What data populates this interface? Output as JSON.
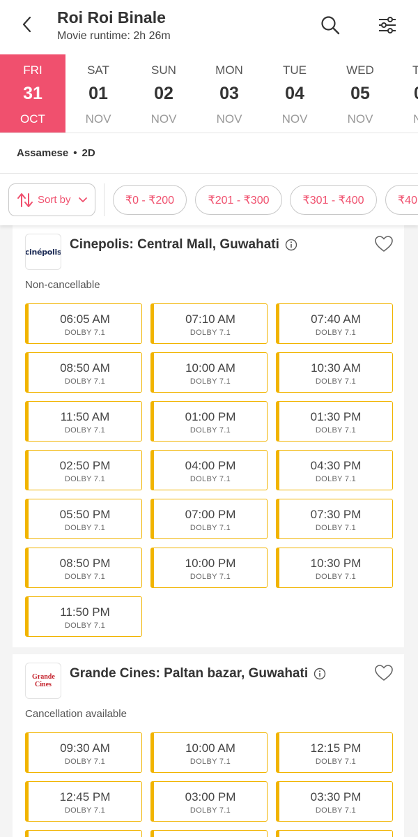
{
  "header": {
    "title": "Roi Roi Binale",
    "subtitle": "Movie runtime: 2h 26m"
  },
  "dates": [
    {
      "dow": "FRI",
      "day": "31",
      "mon": "OCT",
      "active": true
    },
    {
      "dow": "SAT",
      "day": "01",
      "mon": "NOV"
    },
    {
      "dow": "SUN",
      "day": "02",
      "mon": "NOV"
    },
    {
      "dow": "MON",
      "day": "03",
      "mon": "NOV"
    },
    {
      "dow": "TUE",
      "day": "04",
      "mon": "NOV"
    },
    {
      "dow": "WED",
      "day": "05",
      "mon": "NOV"
    },
    {
      "dow": "T",
      "day": "0",
      "mon": "N"
    }
  ],
  "language": {
    "lang": "Assamese",
    "dot": "•",
    "format": "2D"
  },
  "filters": {
    "sort_label": "Sort by",
    "chips": [
      "₹0 - ₹200",
      "₹201 - ₹300",
      "₹301 - ₹400",
      "₹40"
    ]
  },
  "cinemas": [
    {
      "logo_text": "cinépolis",
      "name": "Cinepolis: Central Mall, Guwahati",
      "note": "Non-cancellable",
      "shows": [
        {
          "time": "06:05 AM",
          "format": "DOLBY 7.1"
        },
        {
          "time": "07:10 AM",
          "format": "DOLBY 7.1"
        },
        {
          "time": "07:40 AM",
          "format": "DOLBY 7.1"
        },
        {
          "time": "08:50 AM",
          "format": "DOLBY 7.1"
        },
        {
          "time": "10:00 AM",
          "format": "DOLBY 7.1"
        },
        {
          "time": "10:30 AM",
          "format": "DOLBY 7.1"
        },
        {
          "time": "11:50 AM",
          "format": "DOLBY 7.1"
        },
        {
          "time": "01:00 PM",
          "format": "DOLBY 7.1"
        },
        {
          "time": "01:30 PM",
          "format": "DOLBY 7.1"
        },
        {
          "time": "02:50 PM",
          "format": "DOLBY 7.1"
        },
        {
          "time": "04:00 PM",
          "format": "DOLBY 7.1"
        },
        {
          "time": "04:30 PM",
          "format": "DOLBY 7.1"
        },
        {
          "time": "05:50 PM",
          "format": "DOLBY 7.1"
        },
        {
          "time": "07:00 PM",
          "format": "DOLBY 7.1"
        },
        {
          "time": "07:30 PM",
          "format": "DOLBY 7.1"
        },
        {
          "time": "08:50 PM",
          "format": "DOLBY 7.1"
        },
        {
          "time": "10:00 PM",
          "format": "DOLBY 7.1"
        },
        {
          "time": "10:30 PM",
          "format": "DOLBY 7.1"
        },
        {
          "time": "11:50 PM",
          "format": "DOLBY 7.1"
        }
      ]
    },
    {
      "logo_text": "Grande Cines",
      "name": "Grande Cines: Paltan bazar, Guwahati",
      "note": "Cancellation available",
      "shows": [
        {
          "time": "09:30 AM",
          "format": "DOLBY 7.1"
        },
        {
          "time": "10:00 AM",
          "format": "DOLBY 7.1"
        },
        {
          "time": "12:15 PM",
          "format": "DOLBY 7.1"
        },
        {
          "time": "12:45 PM",
          "format": "DOLBY 7.1"
        },
        {
          "time": "03:00 PM",
          "format": "DOLBY 7.1"
        },
        {
          "time": "03:30 PM",
          "format": "DOLBY 7.1"
        }
      ]
    }
  ],
  "colors": {
    "accent": "#f0506e",
    "slot_border": "#f1b400"
  }
}
